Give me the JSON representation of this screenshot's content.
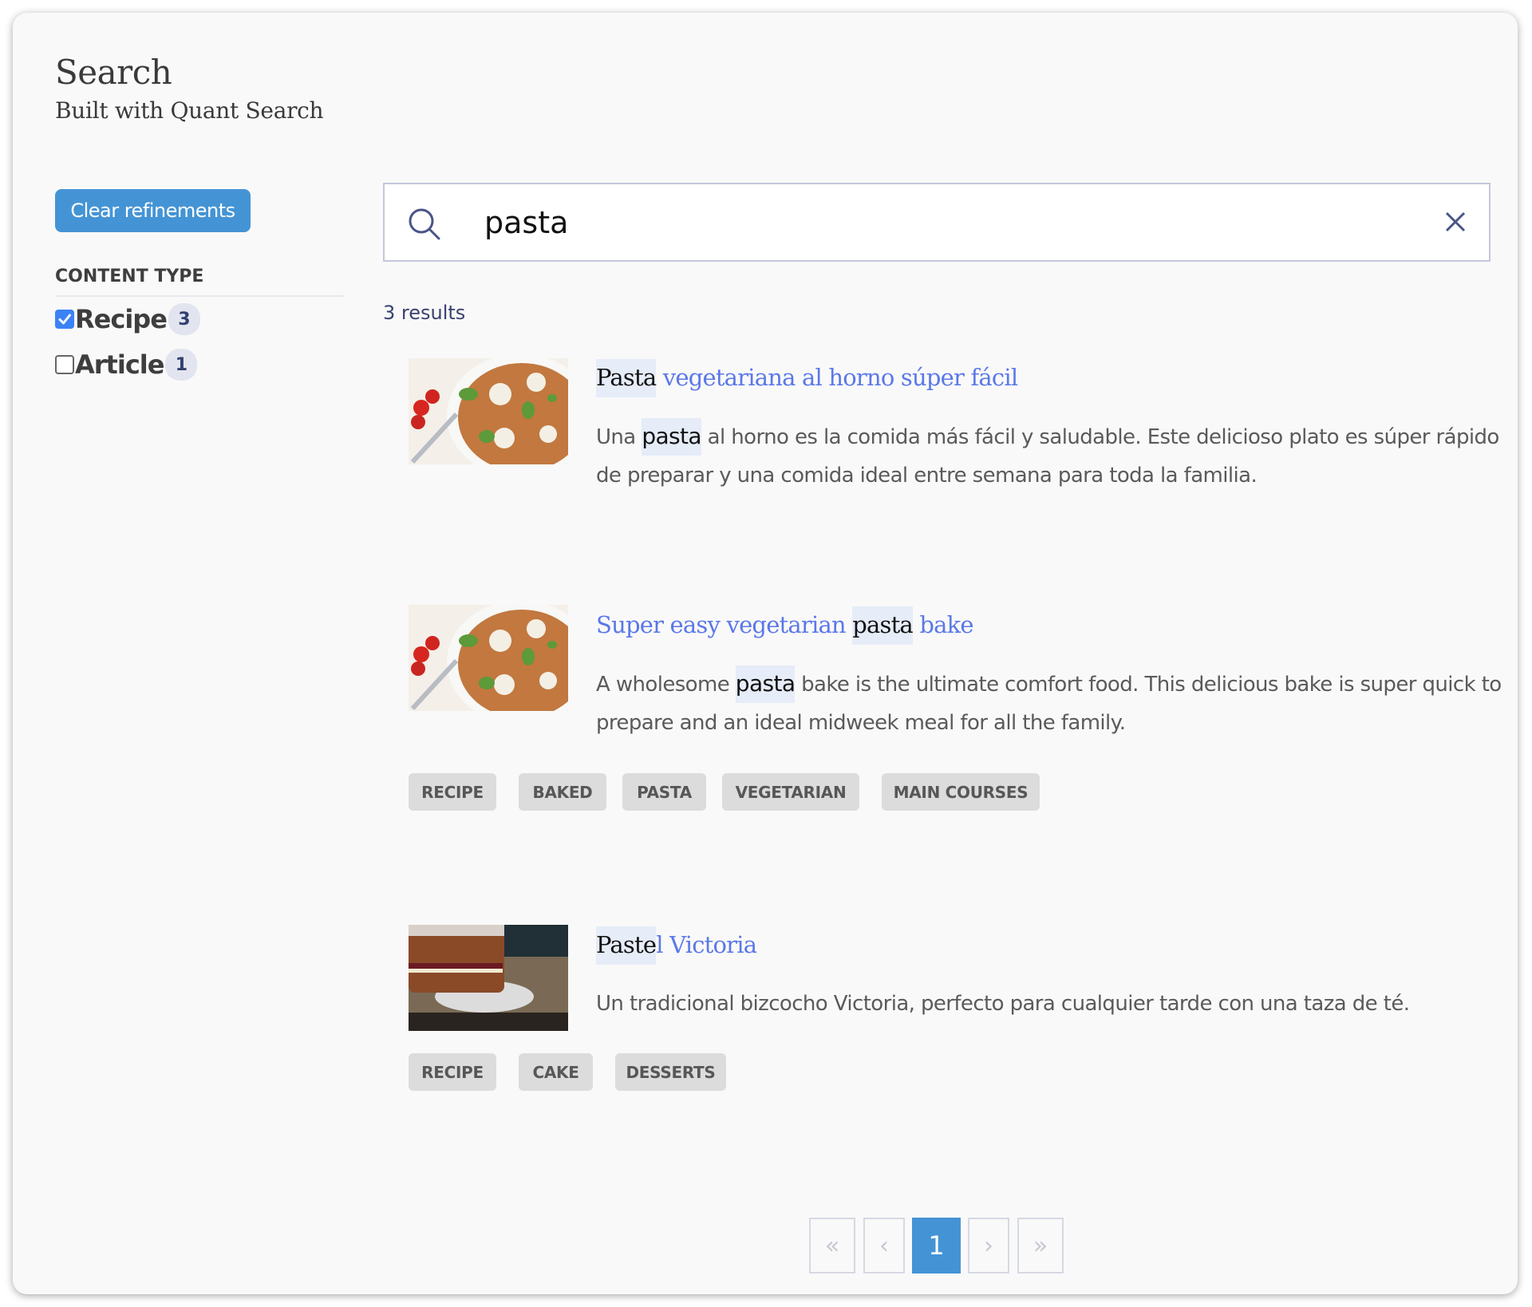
{
  "header": {
    "title": "Search",
    "subtitle": "Built with Quant Search"
  },
  "sidebar": {
    "clear_label": "Clear refinements",
    "facet_title": "CONTENT TYPE",
    "facets": [
      {
        "label": "Recipe",
        "count": "3",
        "checked": true
      },
      {
        "label": "Article",
        "count": "1",
        "checked": false
      }
    ]
  },
  "search": {
    "value": "pasta",
    "placeholder": ""
  },
  "results_count": "3 results",
  "results": [
    {
      "image": "pasta-bake-photo",
      "title_hl": "Pasta",
      "title_rest": " vegetariana al horno súper fácil",
      "desc_pre": "Una ",
      "desc_hl": "pasta",
      "desc_post": " al horno es la comida más fácil y saludable. Este delicioso plato es súper rápido de preparar y una comida ideal entre semana para toda la familia.",
      "tags": []
    },
    {
      "image": "pasta-bake-photo",
      "title_pre": "Super easy vegetarian ",
      "title_hl": "pasta",
      "title_rest": " bake",
      "desc_pre": "A wholesome ",
      "desc_hl": "pasta",
      "desc_post": " bake is the ultimate comfort food. This delicious bake is super quick to prepare and an ideal midweek meal for all the family.",
      "tags": [
        "RECIPE",
        "BAKED",
        "PASTA",
        "VEGETARIAN",
        "MAIN COURSES"
      ]
    },
    {
      "image": "victoria-sponge-cake-photo",
      "title_hl": "Paste",
      "title_rest": "l Victoria",
      "desc": "Un tradicional bizcocho Victoria, perfecto para cualquier tarde con una taza de té.",
      "tags": [
        "RECIPE",
        "CAKE",
        "DESSERTS"
      ]
    }
  ],
  "pagination": {
    "first": "«",
    "prev": "‹",
    "current": "1",
    "next": "›",
    "last": "»"
  },
  "colors": {
    "accent": "#4494d5",
    "link": "#5b78e8",
    "highlight": "#e6ecf8",
    "tag_bg": "#dcdcdc",
    "checkbox": "#3b82f6"
  }
}
